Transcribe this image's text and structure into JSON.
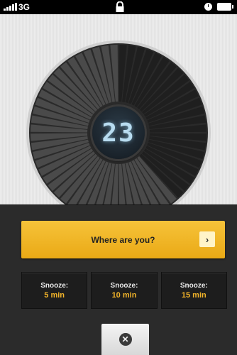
{
  "status_bar": {
    "network": "3G",
    "signal_icon": "signal-bars-icon",
    "lock_icon": "lock-icon",
    "alarm_icon": "clock-icon",
    "battery_icon": "battery-icon"
  },
  "timer": {
    "value": "23",
    "progress_fraction": 0.38
  },
  "main_button": {
    "label": "Where are you?",
    "chevron": "›"
  },
  "snooze_options": [
    {
      "title": "Snooze:",
      "value": "5 min"
    },
    {
      "title": "Snooze:",
      "value": "10 min"
    },
    {
      "title": "Snooze:",
      "value": "15 min"
    }
  ],
  "dismiss_button": {
    "icon": "close-icon",
    "glyph": "✕"
  },
  "colors": {
    "accent": "#f2b42a",
    "dial_dark": "#1f1f1f",
    "dial_light": "#4a4a4a"
  }
}
